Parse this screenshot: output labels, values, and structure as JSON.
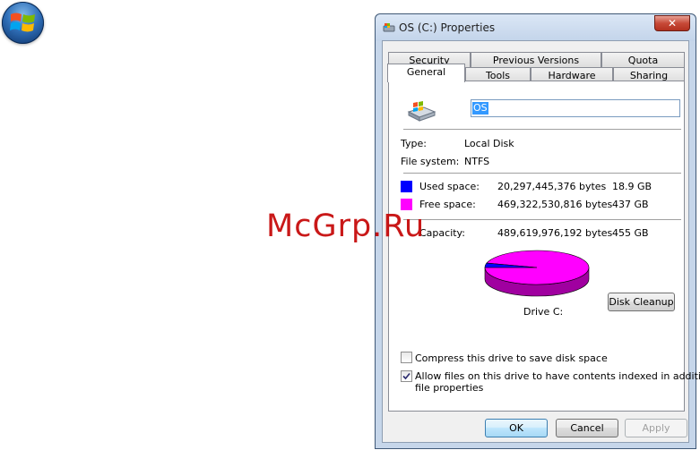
{
  "desktop": {
    "start_orb_icon": "windows-logo-icon"
  },
  "watermark": {
    "text": "McGrp.Ru"
  },
  "window": {
    "title": "OS (C:) Properties",
    "title_icon": "drive-icon",
    "close_glyph": "✕",
    "tabs_row1": [
      "Security",
      "Previous Versions",
      "Quota"
    ],
    "tabs_row2": [
      "General",
      "Tools",
      "Hardware",
      "Sharing"
    ],
    "active_tab": "General"
  },
  "general": {
    "drive_icon": "drive-icon",
    "drive_name": "OS",
    "type_label": "Type:",
    "type_value": "Local Disk",
    "fs_label": "File system:",
    "fs_value": "NTFS",
    "used_label": "Used space:",
    "used_bytes": "20,297,445,376 bytes",
    "used_gb": "18.9 GB",
    "free_label": "Free space:",
    "free_bytes": "469,322,530,816 bytes",
    "free_gb": "437 GB",
    "capacity_label": "Capacity:",
    "capacity_bytes": "489,619,976,192 bytes",
    "capacity_gb": "455 GB",
    "used_color": "#0000ff",
    "free_color": "#ff00ff",
    "used_fraction": 0.0415,
    "drive_label": "Drive C:",
    "disk_cleanup": "Disk Cleanup",
    "compress_label": "Compress this drive to save disk space",
    "compress_checked": false,
    "index_label_line1": "Allow files on this drive to have contents indexed in addition to",
    "index_label_line2": "file properties",
    "index_checked": true
  },
  "buttons": {
    "ok": "OK",
    "cancel": "Cancel",
    "apply": "Apply"
  }
}
